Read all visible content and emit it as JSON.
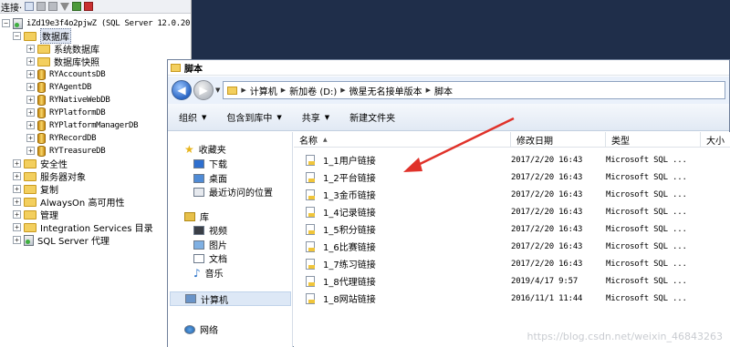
{
  "ssms": {
    "toolbar": {
      "connect_label": "连接·"
    },
    "tree": {
      "server": "iZd19e3f4o2pjwZ (SQL Server 12.0.20",
      "databases": "数据库",
      "system_dbs": "系统数据库",
      "snapshots": "数据库快照",
      "db_items": [
        "RYAccountsDB",
        "RYAgentDB",
        "RYNativeWebDB",
        "RYPlatformDB",
        "RYPlatformManagerDB",
        "RYRecordDB",
        "RYTreasureDB"
      ],
      "security": "安全性",
      "server_objects": "服务器对象",
      "replication": "复制",
      "alwayson": "AlwaysOn 高可用性",
      "management": "管理",
      "integration": "Integration Services 目录",
      "agent": "SQL Server 代理"
    }
  },
  "explorer": {
    "title": "脚本",
    "breadcrumbs": [
      "计算机",
      "新加卷 (D:)",
      "微星无名接单版本",
      "脚本"
    ],
    "commands": [
      {
        "label": "组织",
        "dropdown": true
      },
      {
        "label": "包含到库中",
        "dropdown": true
      },
      {
        "label": "共享",
        "dropdown": true
      },
      {
        "label": "新建文件夹",
        "dropdown": false
      }
    ],
    "nav": {
      "favorites": "收藏夹",
      "downloads": "下载",
      "desktop": "桌面",
      "recent": "最近访问的位置",
      "libraries": "库",
      "videos": "视频",
      "pictures": "图片",
      "documents": "文档",
      "music": "音乐",
      "computer": "计算机",
      "network": "网络"
    },
    "columns": {
      "name": "名称",
      "date": "修改日期",
      "type": "类型",
      "size": "大小"
    },
    "files": [
      {
        "name": "1_1用户链接",
        "date": "2017/2/20 16:43",
        "type": "Microsoft SQL ..."
      },
      {
        "name": "1_2平台链接",
        "date": "2017/2/20 16:43",
        "type": "Microsoft SQL ..."
      },
      {
        "name": "1_3金币链接",
        "date": "2017/2/20 16:43",
        "type": "Microsoft SQL ..."
      },
      {
        "name": "1_4记录链接",
        "date": "2017/2/20 16:43",
        "type": "Microsoft SQL ..."
      },
      {
        "name": "1_5积分链接",
        "date": "2017/2/20 16:43",
        "type": "Microsoft SQL ..."
      },
      {
        "name": "1_6比赛链接",
        "date": "2017/2/20 16:43",
        "type": "Microsoft SQL ..."
      },
      {
        "name": "1_7练习链接",
        "date": "2017/2/20 16:43",
        "type": "Microsoft SQL ..."
      },
      {
        "name": "1_8代理链接",
        "date": "2019/4/17 9:57",
        "type": "Microsoft SQL ..."
      },
      {
        "name": "1_8网站链接",
        "date": "2016/11/1 11:44",
        "type": "Microsoft SQL ..."
      }
    ]
  },
  "watermark": "https://blog.csdn.net/weixin_46843263",
  "colors": {
    "annotation_arrow": "#e0322a",
    "desktop_bg": "#1f2e4a"
  }
}
